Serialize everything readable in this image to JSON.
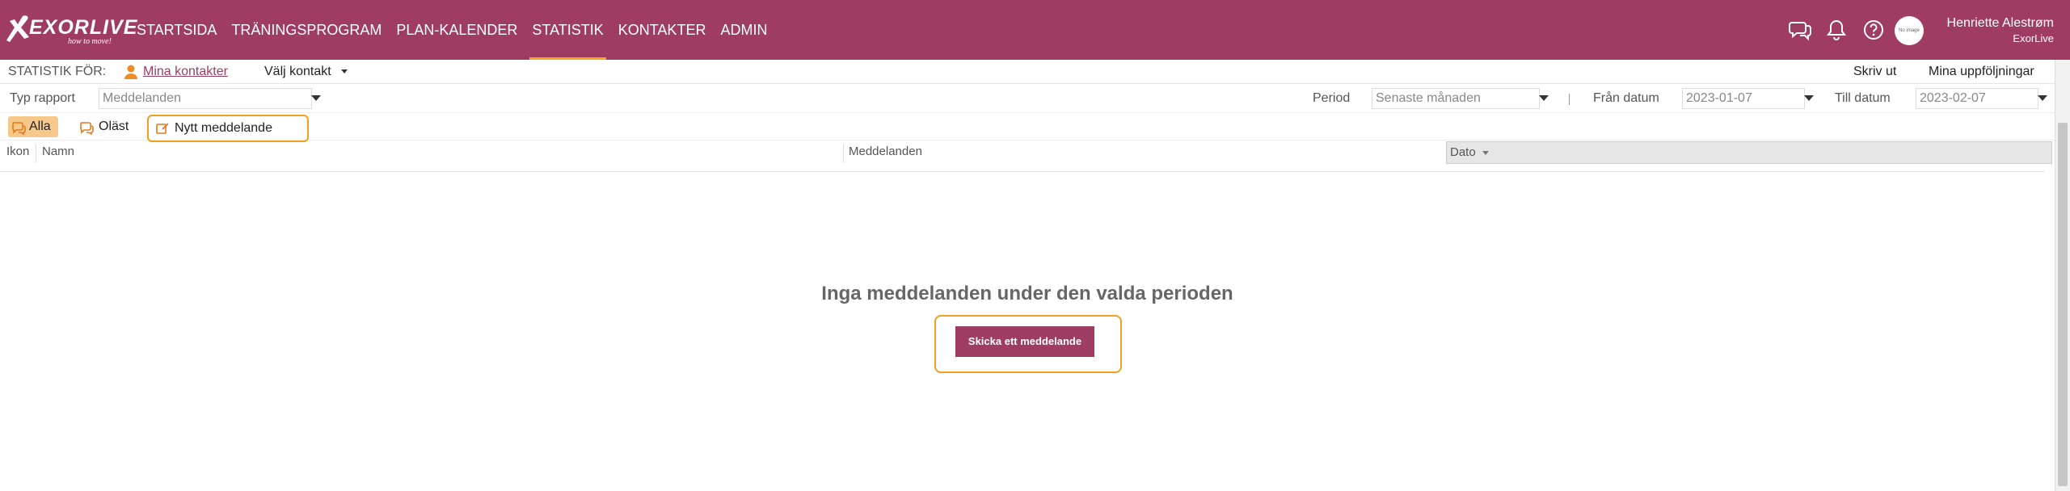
{
  "brand": {
    "name": "EXORLIVE",
    "tagline": "how to move!"
  },
  "nav": {
    "items": [
      {
        "label": "STARTSIDA",
        "active": false
      },
      {
        "label": "TRÄNINGSPROGRAM",
        "active": false
      },
      {
        "label": "PLAN-KALENDER",
        "active": false
      },
      {
        "label": "STATISTIK",
        "active": true
      },
      {
        "label": "KONTAKTER",
        "active": false
      },
      {
        "label": "ADMIN",
        "active": false
      }
    ]
  },
  "user": {
    "name": "Henriette Alestrøm",
    "org": "ExorLive",
    "avatar_text": "No image"
  },
  "colors": {
    "brand": "#9e3d61",
    "accent": "#f0a020",
    "filter_active": "#f6c98a"
  },
  "stat_bar": {
    "label": "STATISTIK FÖR:",
    "my_contacts": "Mina kontakter",
    "choose_contact": "Välj kontakt",
    "print": "Skriv ut",
    "followups": "Mina uppföljningar"
  },
  "report": {
    "type_label": "Typ rapport",
    "type_value": "Meddelanden",
    "period_label": "Period",
    "period_value": "Senaste månaden",
    "from_label": "Från datum",
    "from_value": "2023-01-07",
    "to_label": "Till datum",
    "to_value": "2023-02-07"
  },
  "filters": {
    "all": "Alla",
    "unread": "Oläst",
    "new_message": "Nytt meddelande"
  },
  "table": {
    "columns": [
      "Ikon",
      "Namn",
      "Meddelanden",
      "Dato"
    ],
    "sorted_column": "Dato"
  },
  "empty_state": {
    "title": "Inga meddelanden under den valda perioden",
    "button": "Skicka ett meddelande"
  }
}
